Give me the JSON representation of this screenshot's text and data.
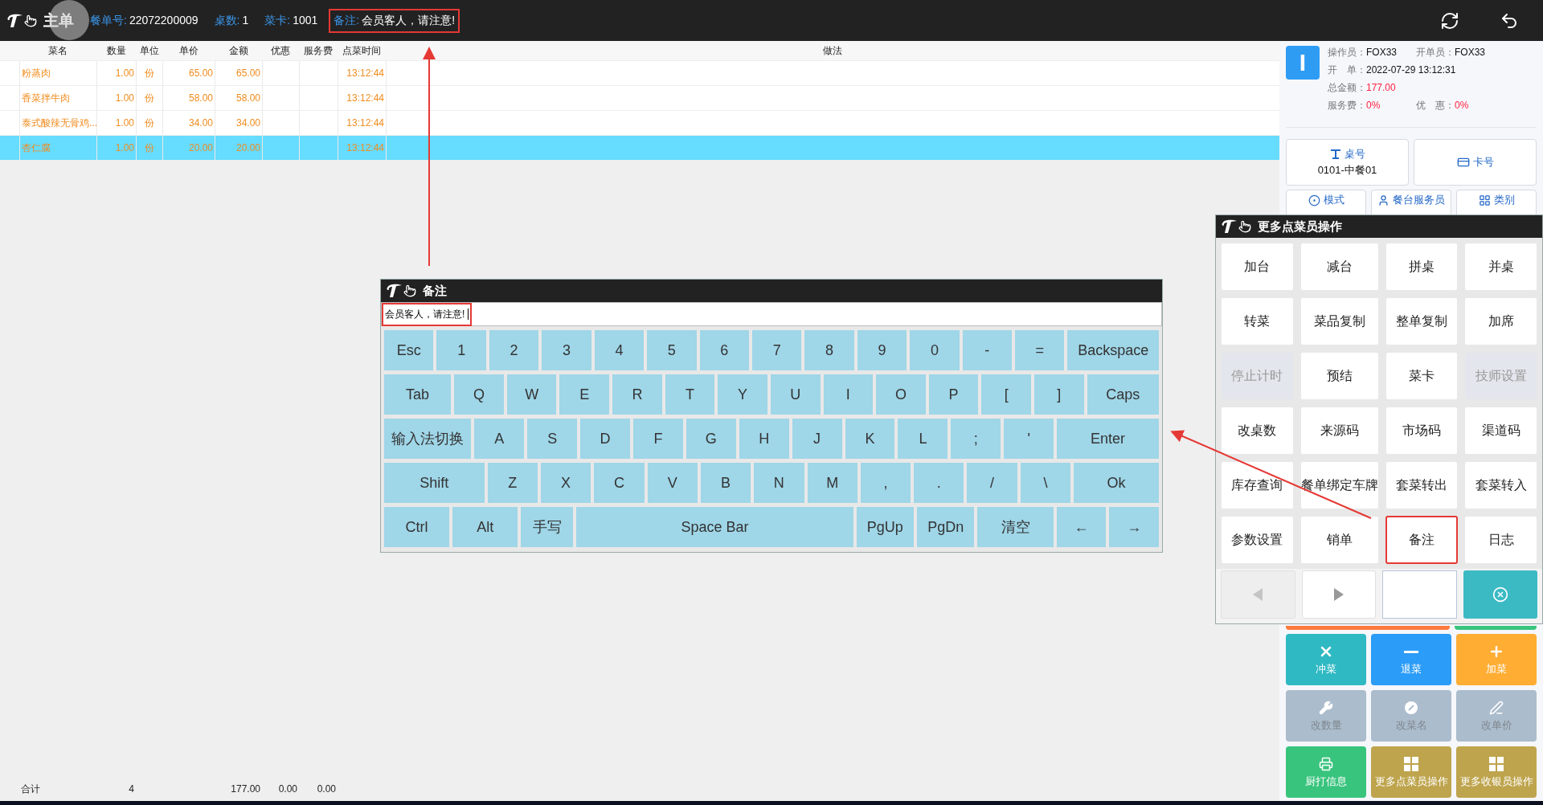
{
  "header": {
    "title": "主单",
    "fields": [
      {
        "label": "餐单号:",
        "value": "22072200009",
        "highlighted": false
      },
      {
        "label": "桌数:",
        "value": "1",
        "highlighted": false
      },
      {
        "label": "菜卡:",
        "value": "1001",
        "highlighted": false
      },
      {
        "label": "备注:",
        "value": "会员客人，请注意!",
        "highlighted": true
      }
    ]
  },
  "table": {
    "columns": [
      "菜名",
      "数量",
      "单位",
      "单价",
      "金额",
      "优惠",
      "服务费",
      "点菜时间",
      "做法"
    ],
    "rows": [
      {
        "name": "粉蒸肉",
        "qty": "1.00",
        "unit": "份",
        "price": "65.00",
        "amount": "65.00",
        "time": "13:12:44",
        "selected": false
      },
      {
        "name": "香菜拌牛肉",
        "qty": "1.00",
        "unit": "份",
        "price": "58.00",
        "amount": "58.00",
        "time": "13:12:44",
        "selected": false
      },
      {
        "name": "泰式酸辣无骨鸡...",
        "qty": "1.00",
        "unit": "份",
        "price": "34.00",
        "amount": "34.00",
        "time": "13:12:44",
        "selected": false
      },
      {
        "name": "杏仁腐",
        "qty": "1.00",
        "unit": "份",
        "price": "20.00",
        "amount": "20.00",
        "time": "13:12:44",
        "selected": true
      }
    ],
    "totals": {
      "label": "合计",
      "qty": "4",
      "amount": "177.00",
      "discount": "0.00",
      "service": "0.00"
    }
  },
  "info": {
    "avatar": "I",
    "rows": [
      {
        "items": [
          {
            "label": "操作员：",
            "value": "FOX33",
            "alert": false
          },
          {
            "label": "开单员：",
            "value": "FOX33",
            "alert": false
          }
        ]
      },
      {
        "items": [
          {
            "label": "开　单：",
            "value": "2022-07-29 13:12:31",
            "alert": false
          }
        ]
      },
      {
        "items": [
          {
            "label": "总金额：",
            "value": "177.00",
            "alert": true
          }
        ]
      },
      {
        "items": [
          {
            "label": "服务费：",
            "value": "0%",
            "alert": true
          },
          {
            "label": "优　惠：",
            "value": "0%",
            "alert": true
          }
        ]
      }
    ]
  },
  "table_button": {
    "label": "桌号",
    "value": "0101-中餐01"
  },
  "card_button": {
    "label": "卡号"
  },
  "mode_buttons": [
    "模式",
    "餐台服务员",
    "类别"
  ],
  "action_buttons": [
    {
      "label": "冲菜",
      "color": "#2fb9c3",
      "disabled": false
    },
    {
      "label": "退菜",
      "color": "#2b9cf7",
      "disabled": false
    },
    {
      "label": "加菜",
      "color": "#ffad33",
      "disabled": false
    },
    {
      "label": "改数量",
      "color": "#abbccc",
      "disabled": true
    },
    {
      "label": "改菜名",
      "color": "#abbccc",
      "disabled": true
    },
    {
      "label": "改单价",
      "color": "#abbccc",
      "disabled": true
    },
    {
      "label": "厨打信息",
      "color": "#39c47e",
      "disabled": false
    },
    {
      "label": "更多点菜员操作",
      "color": "#bea44d",
      "disabled": false
    },
    {
      "label": "更多收银员操作",
      "color": "#bea44d",
      "disabled": false
    }
  ],
  "keyboard_dialog": {
    "title": "备注",
    "input": {
      "value": "会员客人，请注意!",
      "highlighted": true
    },
    "key_rows": [
      [
        "Esc",
        "1",
        "2",
        "3",
        "4",
        "5",
        "6",
        "7",
        "8",
        "9",
        "0",
        "-",
        "=",
        "Backspace"
      ],
      [
        "Tab",
        "Q",
        "W",
        "E",
        "R",
        "T",
        "Y",
        "U",
        "I",
        "O",
        "P",
        "[",
        "]",
        "Caps"
      ],
      [
        "输入法切换",
        "A",
        "S",
        "D",
        "F",
        "G",
        "H",
        "J",
        "K",
        "L",
        ";",
        "'",
        "Enter"
      ],
      [
        "Shift",
        "Z",
        "X",
        "C",
        "V",
        "B",
        "N",
        "M",
        ",",
        ".",
        "/",
        "\\",
        "Ok"
      ],
      [
        "Ctrl",
        "Alt",
        "手写",
        "Space Bar",
        "PgUp",
        "PgDn",
        "清空",
        "←",
        "→"
      ]
    ]
  },
  "operations_dialog": {
    "title": "更多点菜员操作",
    "buttons": [
      {
        "label": "加台",
        "disabled": false,
        "highlighted": false
      },
      {
        "label": "减台",
        "disabled": false,
        "highlighted": false
      },
      {
        "label": "拼桌",
        "disabled": false,
        "highlighted": false
      },
      {
        "label": "并桌",
        "disabled": false,
        "highlighted": false
      },
      {
        "label": "转菜",
        "disabled": false,
        "highlighted": false
      },
      {
        "label": "菜品复制",
        "disabled": false,
        "highlighted": false
      },
      {
        "label": "整单复制",
        "disabled": false,
        "highlighted": false
      },
      {
        "label": "加席",
        "disabled": false,
        "highlighted": false
      },
      {
        "label": "停止计时",
        "disabled": true,
        "highlighted": false
      },
      {
        "label": "预结",
        "disabled": false,
        "highlighted": false
      },
      {
        "label": "菜卡",
        "disabled": false,
        "highlighted": false
      },
      {
        "label": "技师设置",
        "disabled": true,
        "highlighted": false
      },
      {
        "label": "改桌数",
        "disabled": false,
        "highlighted": false
      },
      {
        "label": "来源码",
        "disabled": false,
        "highlighted": false
      },
      {
        "label": "市场码",
        "disabled": false,
        "highlighted": false
      },
      {
        "label": "渠道码",
        "disabled": false,
        "highlighted": false
      },
      {
        "label": "库存查询",
        "disabled": false,
        "highlighted": false
      },
      {
        "label": "餐单绑定车牌",
        "disabled": false,
        "highlighted": false
      },
      {
        "label": "套菜转出",
        "disabled": false,
        "highlighted": false
      },
      {
        "label": "套菜转入",
        "disabled": false,
        "highlighted": false
      },
      {
        "label": "参数设置",
        "disabled": false,
        "highlighted": false
      },
      {
        "label": "销单",
        "disabled": false,
        "highlighted": false
      },
      {
        "label": "备注",
        "disabled": false,
        "highlighted": true
      },
      {
        "label": "日志",
        "disabled": false,
        "highlighted": false
      }
    ],
    "prev_disabled": true
  }
}
